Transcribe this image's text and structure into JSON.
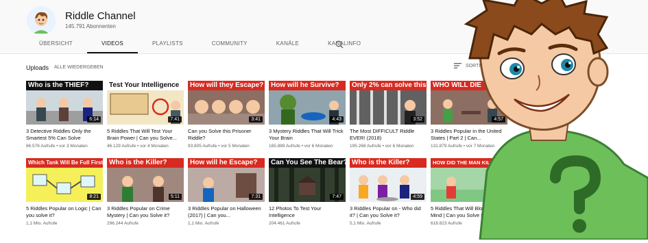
{
  "channel": {
    "name": "Riddle Channel",
    "subscribers": "145.791 Abonnenten"
  },
  "tabs": [
    "ÜBERSICHT",
    "VIDEOS",
    "PLAYLISTS",
    "COMMUNITY",
    "KANÄLE",
    "KANALINFO"
  ],
  "active_tab": "VIDEOS",
  "uploads": {
    "label": "Uploads",
    "play_all": "ALLE WIEDERGEBEN",
    "sort_label": "SORTIER"
  },
  "row1": [
    {
      "banner": "Who is the THIEF?",
      "duration": "6:14",
      "title": "3 Detective Riddles Only the Smartest 5% Can Solve",
      "meta": "86.576 Aufrufe • vor 3 Monaten"
    },
    {
      "banner": "Test Your Intelligence",
      "duration": "7:41",
      "title": "5 Riddles That Will Test Your Brain Power | Can you Solve...",
      "meta": "46.129 Aufrufe • vor 4 Monaten"
    },
    {
      "banner": "How will they Escape?",
      "duration": "3:41",
      "title": "Can you Solve this Prisoner Riddle?",
      "meta": "93.805 Aufrufe • vor 5 Monaten"
    },
    {
      "banner": "How will he Survive?",
      "duration": "4:43",
      "title": "3 Mystery Riddles That Will Trick Your Brain",
      "meta": "165.889 Aufrufe • vor 6 Monaten"
    },
    {
      "banner": "Only 2% can solve this!",
      "duration": "3:52",
      "title": "The Most DIFFICULT Riddle EVER! (2018)",
      "meta": "195.268 Aufrufe • vor 6 Monaten"
    },
    {
      "banner": "WHO WILL DIE",
      "duration": "4:57",
      "title": "3 Riddles Popular in the United States | Part 2 | Can...",
      "meta": "131.879 Aufrufe • vor 7 Monaten"
    }
  ],
  "row2": [
    {
      "banner": "Which Tank Will Be Full First?",
      "duration": "8:21",
      "title": "5 Riddles Popular on Logic | Can you solve it?",
      "meta": "1,1 Mio. Aufrufe"
    },
    {
      "banner": "Who is the Killer?",
      "duration": "5:11",
      "title": "3 Riddles Popular on Crime Mystery | Can you Solve it?",
      "meta": "296.244 Aufrufe"
    },
    {
      "banner": "How will he Escape?",
      "duration": "7:31",
      "title": "3 Riddles Popular on Halloween (2017) | Can you...",
      "meta": "1,1 Mio. Aufrufe"
    },
    {
      "banner": "Can You See The Bear?",
      "duration": "7:47",
      "title": "12 Photos To Test Your Intelligence",
      "meta": "204.461 Aufrufe"
    },
    {
      "banner": "Who is the Killer?",
      "duration": "4:59",
      "title": "3 Riddles Popular on - Who did it? | Can you Solve it?",
      "meta": "5,1 Mio. Aufrufe"
    },
    {
      "banner": "HOW DID THE MAN KILL HIM",
      "duration": "",
      "title": "5 Riddles That Will Blow Your Mind | Can you Solve it?",
      "meta": "618.823 Aufrufe"
    }
  ],
  "colors": {
    "red": "#d82a20",
    "green": "#6dbf5a",
    "skin": "#f4c9a3",
    "hair": "#8b4a1c"
  }
}
